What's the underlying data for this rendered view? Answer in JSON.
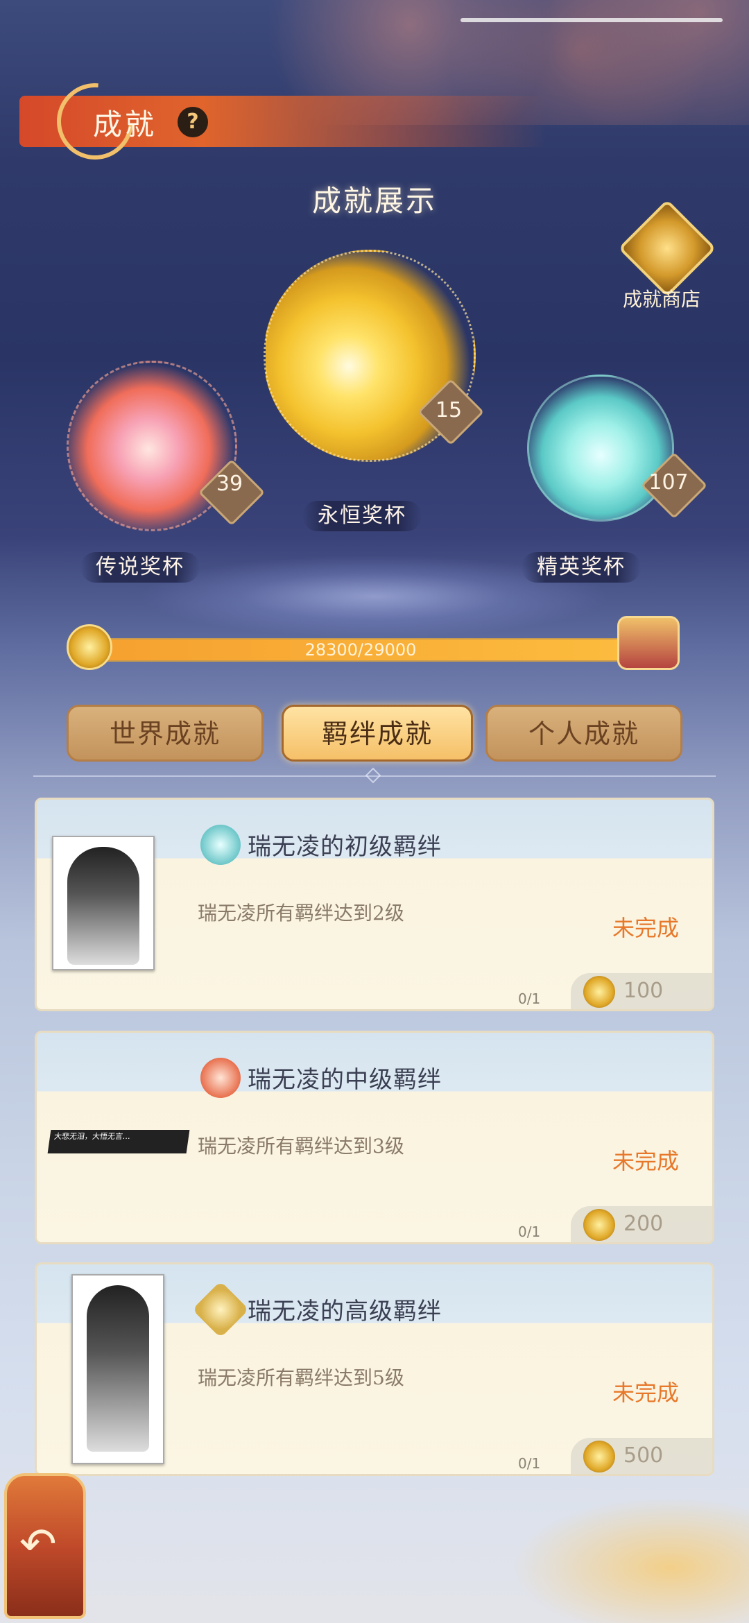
{
  "header": {
    "title": "成就",
    "help_glyph": "?"
  },
  "showcase": {
    "title": "成就展示"
  },
  "shop": {
    "label": "成就商店",
    "icon": "dragon-lotus-icon"
  },
  "trophies": [
    {
      "name": "传说奖杯",
      "count": "39",
      "color": "#f06d5a"
    },
    {
      "name": "永恒奖杯",
      "count": "15",
      "color": "#f4c22e"
    },
    {
      "name": "精英奖杯",
      "count": "107",
      "color": "#5bc9c6"
    }
  ],
  "progress": {
    "text": "28300/29000",
    "current": 28300,
    "max": 29000
  },
  "tabs": [
    {
      "label": "世界成就",
      "active": false
    },
    {
      "label": "羁绊成就",
      "active": true
    },
    {
      "label": "个人成就",
      "active": false
    }
  ],
  "cards": [
    {
      "title": "瑞无凌的初级羁绊",
      "desc": "瑞无凌所有羁绊达到2级",
      "status": "未完成",
      "progress": "0/1",
      "reward": "100",
      "emblem_color": "#6cc6c8"
    },
    {
      "title": "瑞无凌的中级羁绊",
      "desc": "瑞无凌所有羁绊达到3级",
      "status": "未完成",
      "progress": "0/1",
      "reward": "200",
      "emblem_color": "#e8704e",
      "quote": "大悲无泪，大悟无言…"
    },
    {
      "title": "瑞无凌的高级羁绊",
      "desc": "瑞无凌所有羁绊达到5级",
      "status": "未完成",
      "progress": "0/1",
      "reward": "500",
      "emblem_color": "#d9b14a"
    }
  ],
  "colors": {
    "accent_orange": "#e7782a",
    "banner_red": "#d5492a",
    "gold": "#f4c22e"
  }
}
